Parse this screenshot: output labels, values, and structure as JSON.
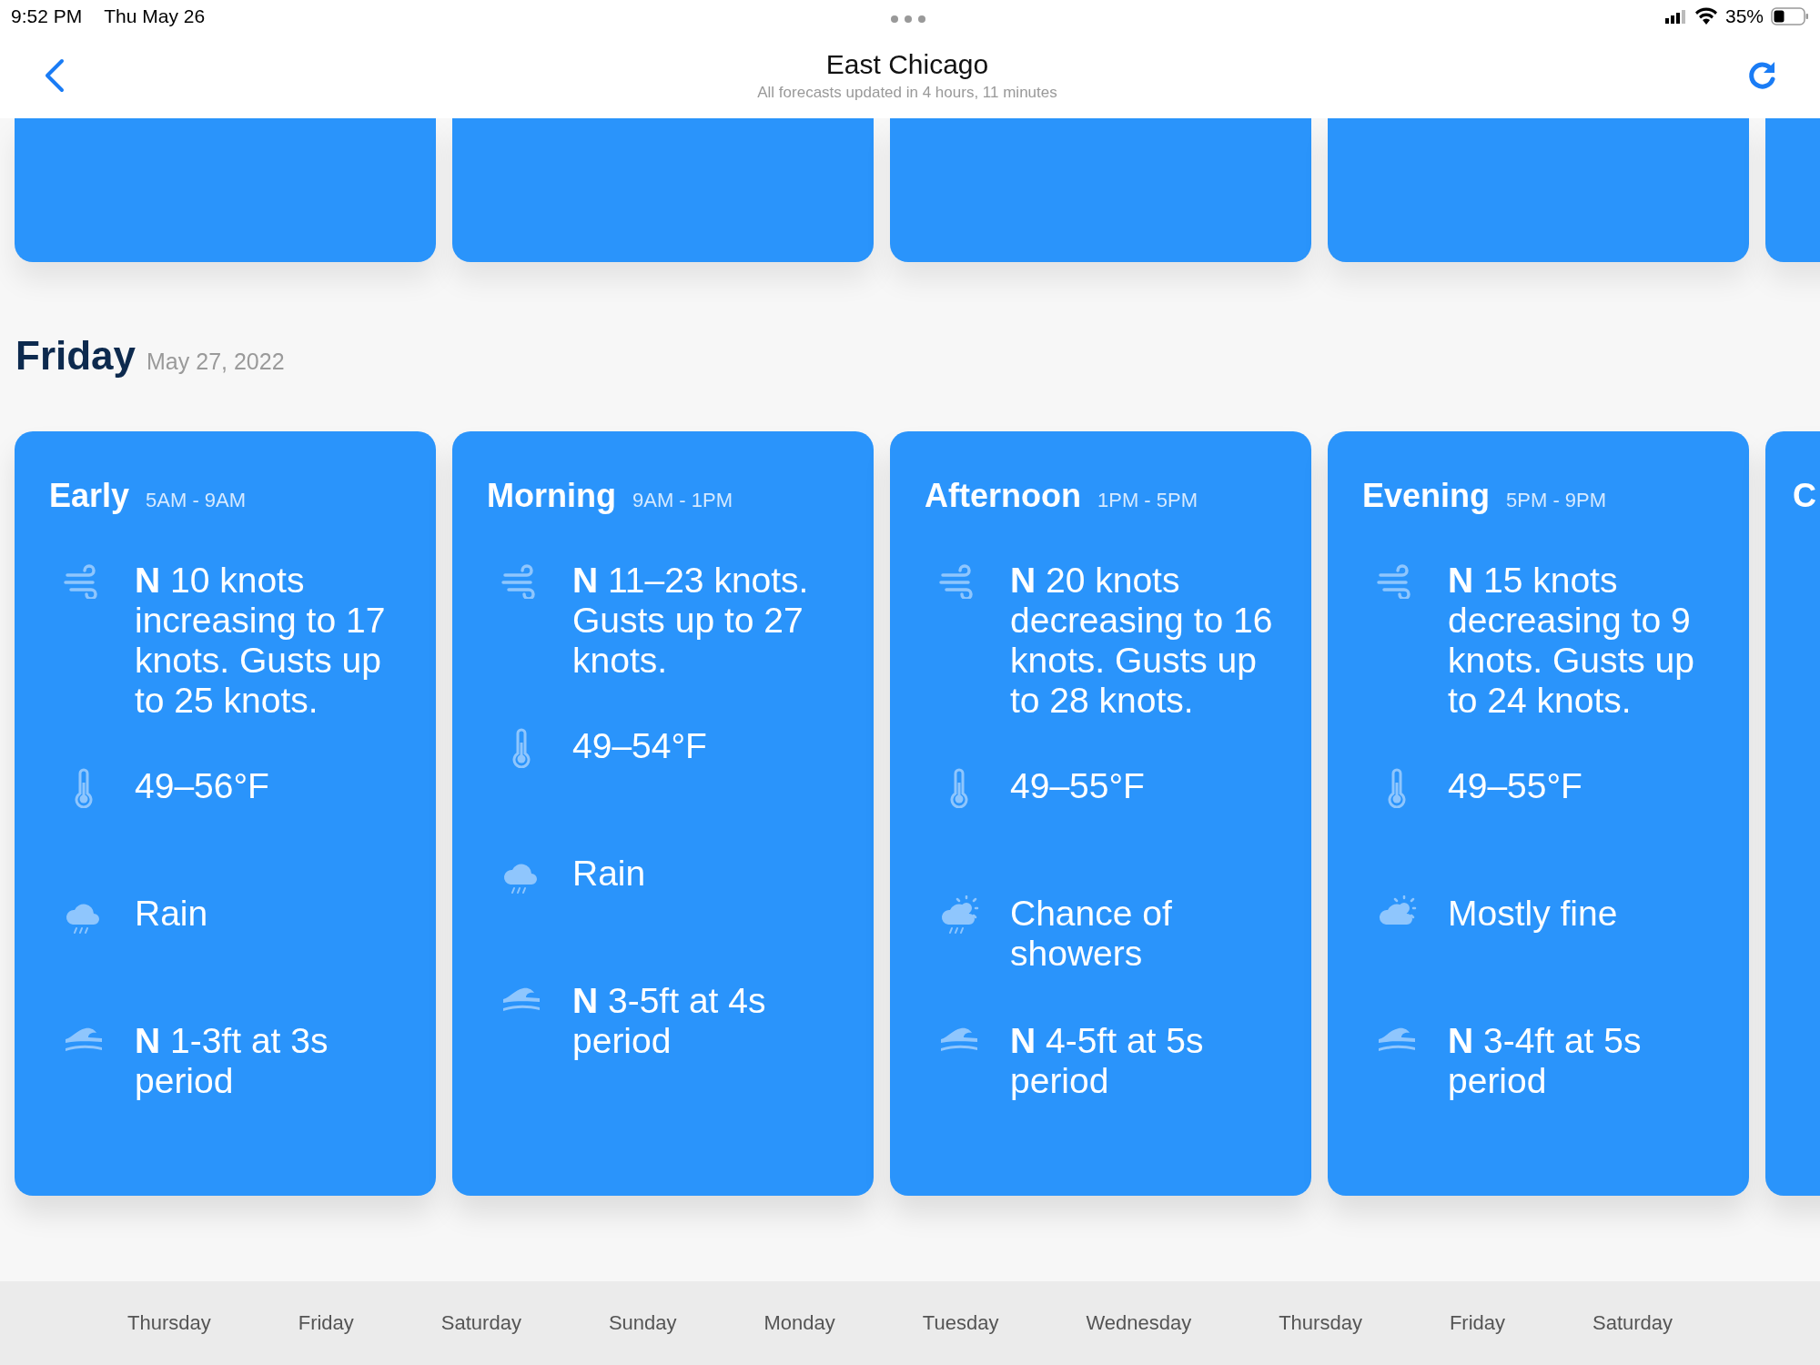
{
  "status_bar": {
    "time": "9:52 PM",
    "date": "Thu May 26",
    "battery": "35%"
  },
  "nav": {
    "title": "East Chicago",
    "subtitle": "All forecasts updated in 4 hours, 11 minutes"
  },
  "day": {
    "name": "Friday",
    "date": "May 27, 2022",
    "periods": [
      {
        "kind": "full",
        "title": "Early",
        "hours": "5AM - 9AM",
        "wind": "**N** 10 knots increasing to 17 knots. Gusts up to 25 knots.",
        "temperature": "49–56°F",
        "condition": {
          "kind": "rain",
          "text": "Rain"
        },
        "seas": "**N** 1-3ft at 3s period"
      },
      {
        "kind": "full",
        "title": "Morning",
        "hours": "9AM - 1PM",
        "wind": "**N** 11–23 knots. Gusts up to 27 knots.",
        "temperature": "49–54°F",
        "condition": {
          "kind": "rain",
          "text": "Rain"
        },
        "seas": "**N** 3-5ft at 4s period"
      },
      {
        "kind": "full",
        "title": "Afternoon",
        "hours": "1PM - 5PM",
        "wind": "**N** 20 knots decreasing to 16 knots. Gusts up to 28 knots.",
        "temperature": "49–55°F",
        "condition": {
          "kind": "showers",
          "text": "Chance of showers"
        },
        "seas": "**N** 4-5ft at 5s period"
      },
      {
        "kind": "full",
        "title": "Evening",
        "hours": "5PM - 9PM",
        "wind": "**N** 15 knots decreasing to 9 knots. Gusts up to 24 knots.",
        "temperature": "49–55°F",
        "condition": {
          "kind": "fine",
          "text": "Mostly fine"
        },
        "seas": "**N** 3-4ft at 5s period"
      },
      {
        "kind": "partial",
        "title": "C"
      }
    ]
  },
  "tab_bar": [
    "Thursday",
    "Friday",
    "Saturday",
    "Sunday",
    "Monday",
    "Tuesday",
    "Wednesday",
    "Thursday",
    "Friday",
    "Saturday"
  ]
}
